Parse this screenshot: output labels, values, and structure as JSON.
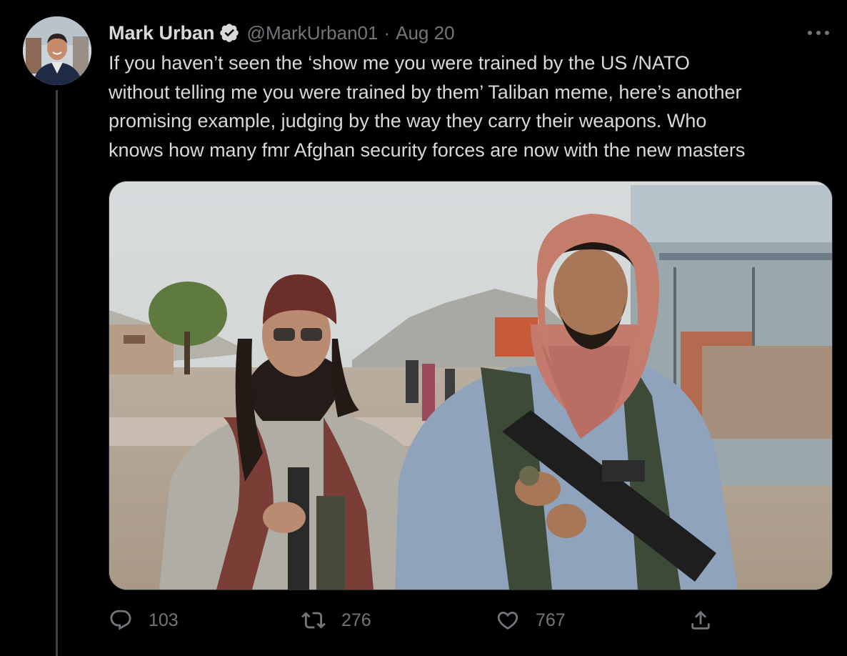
{
  "tweet": {
    "author": {
      "display_name": "Mark Urban",
      "handle": "@MarkUrban01",
      "verified": true
    },
    "separator": "·",
    "date": "Aug 20",
    "text_lines": [
      "If you haven’t seen the ‘show me you were trained by the US /NATO",
      "without telling me you were trained by them’ Taliban meme, here’s another",
      "promising example, judging by the way they carry their weapons. Who",
      "knows how many fmr Afghan security forces are now with the new masters"
    ],
    "media": {
      "kind": "photo",
      "description_alt": "Two armed men in scarves and caps holding rifles on a dusty roadside"
    },
    "actions": {
      "replies": "103",
      "retweets": "276",
      "likes": "767"
    },
    "icons": [
      "more-icon",
      "verified-badge-icon",
      "reply-icon",
      "retweet-icon",
      "like-icon",
      "share-icon"
    ]
  },
  "colors": {
    "background": "#000000",
    "text_primary": "#d9d9d9",
    "text_secondary": "#71767b",
    "verified_badge": "#d9d9d9",
    "thread_line": "#3d4145"
  }
}
